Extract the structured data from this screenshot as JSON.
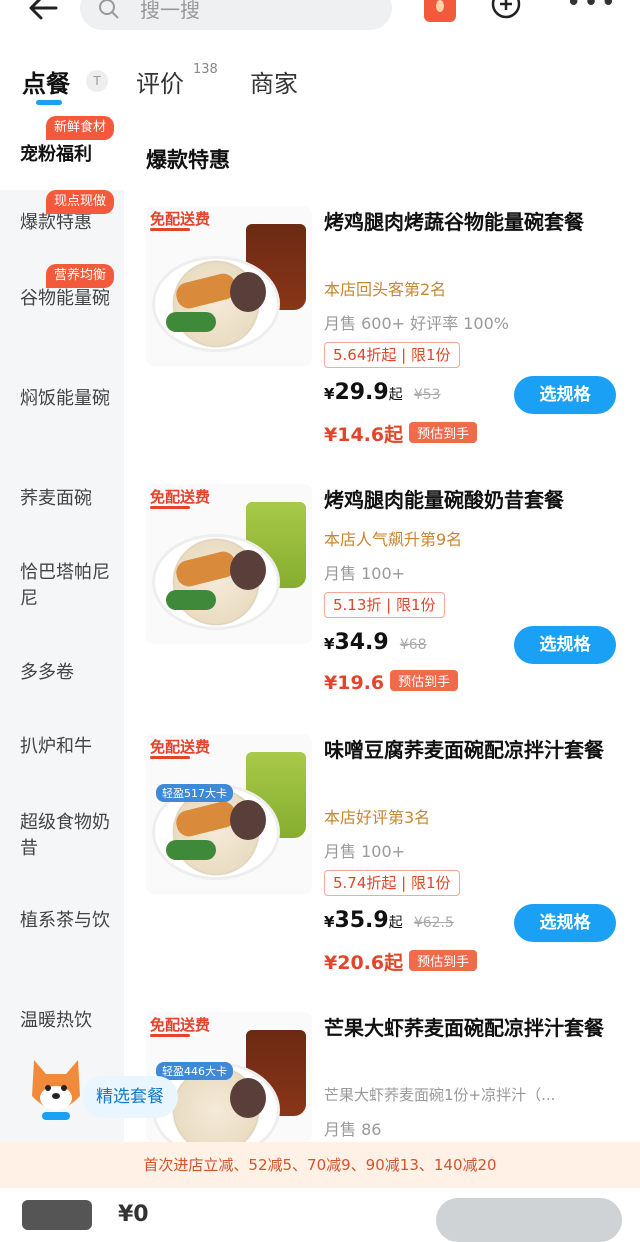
{
  "header": {
    "search_placeholder": "搜一搜"
  },
  "tabs": {
    "order": "点餐",
    "reviews": "评价",
    "reviews_count": "138",
    "merchant": "商家"
  },
  "sidebar": {
    "items": [
      {
        "label": "宠粉福利",
        "tag": "新鲜食材"
      },
      {
        "label": "爆款特惠",
        "tag": "现点现做"
      },
      {
        "label": "谷物能量碗",
        "tag": "营养均衡"
      },
      {
        "label": "焖饭能量碗",
        "tag": ""
      },
      {
        "label": "荞麦面碗",
        "tag": ""
      },
      {
        "label": "恰巴塔帕尼尼",
        "tag": ""
      },
      {
        "label": "多多卷",
        "tag": ""
      },
      {
        "label": "扒炉和牛",
        "tag": ""
      },
      {
        "label": "超级食物奶昔",
        "tag": ""
      },
      {
        "label": "植系茶与饮",
        "tag": ""
      },
      {
        "label": "温暖热饮",
        "tag": ""
      }
    ]
  },
  "section_title": "爆款特惠",
  "products": [
    {
      "promo": "免配送费",
      "name": "烤鸡腿肉烤蔬谷物能量碗套餐",
      "rank": "本店回头客第2名",
      "sales": "月售 600+ 好评率 100%",
      "discount": "5.64折起 | 限1份",
      "price": "29.9",
      "price_suffix": "起",
      "original": "¥53",
      "estimate": "¥14.6起",
      "estimate_tag": "预估到手",
      "button": "选规格"
    },
    {
      "promo": "免配送费",
      "name": "烤鸡腿肉能量碗酸奶昔套餐",
      "rank": "本店人气飙升第9名",
      "sales": "月售 100+",
      "discount": "5.13折 | 限1份",
      "price": "34.9",
      "price_suffix": "",
      "original": "¥68",
      "estimate": "¥19.6",
      "estimate_tag": "预估到手",
      "button": "选规格"
    },
    {
      "promo": "免配送费",
      "kcal": "轻盈517大卡",
      "name": "味噌豆腐荞麦面碗配凉拌汁套餐",
      "rank": "本店好评第3名",
      "sales": "月售 100+",
      "discount": "5.74折起 | 限1份",
      "price": "35.9",
      "price_suffix": "起",
      "original": "¥62.5",
      "estimate": "¥20.6起",
      "estimate_tag": "预估到手",
      "button": "选规格"
    },
    {
      "promo": "免配送费",
      "kcal": "轻盈446大卡",
      "name": "芒果大虾荞麦面碗配凉拌汁套餐",
      "desc": "芒果大虾荞麦面碗1份+凉拌汁（...",
      "sales": "月售 86"
    }
  ],
  "floating": {
    "label": "精选套餐"
  },
  "promo_strip": "首次进店立减、52减5、70减9、90减13、140减20",
  "bottom": {
    "cart_price": "¥0"
  }
}
